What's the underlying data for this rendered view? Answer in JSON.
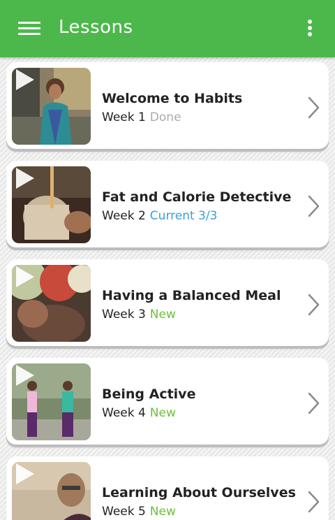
{
  "appbar": {
    "title": "Lessons",
    "menu_icon": "hamburger-menu-icon",
    "overflow_icon": "more-vertical-icon",
    "color": "#4cb84c"
  },
  "lessons": [
    {
      "title": "Welcome to Habits",
      "week": "Week 1",
      "status": "Done",
      "status_type": "done",
      "thumb_icon": "play-icon",
      "chevron_icon": "chevron-right-icon"
    },
    {
      "title": "Fat and Calorie Detective",
      "week": "Week 2",
      "status": "Current 3/3",
      "status_type": "current",
      "thumb_icon": "play-icon",
      "chevron_icon": "chevron-right-icon"
    },
    {
      "title": "Having a Balanced Meal",
      "week": "Week 3",
      "status": "New",
      "status_type": "new",
      "thumb_icon": "play-icon",
      "chevron_icon": "chevron-right-icon"
    },
    {
      "title": "Being Active",
      "week": "Week 4",
      "status": "New",
      "status_type": "new",
      "thumb_icon": "play-icon",
      "chevron_icon": "chevron-right-icon"
    },
    {
      "title": "Learning About Ourselves",
      "week": "Week 5",
      "status": "New",
      "status_type": "new",
      "thumb_icon": "play-icon",
      "chevron_icon": "chevron-right-icon"
    }
  ],
  "status_colors": {
    "done": "#aaaaaa",
    "current": "#3b9fd9",
    "new": "#6cbf3a"
  }
}
